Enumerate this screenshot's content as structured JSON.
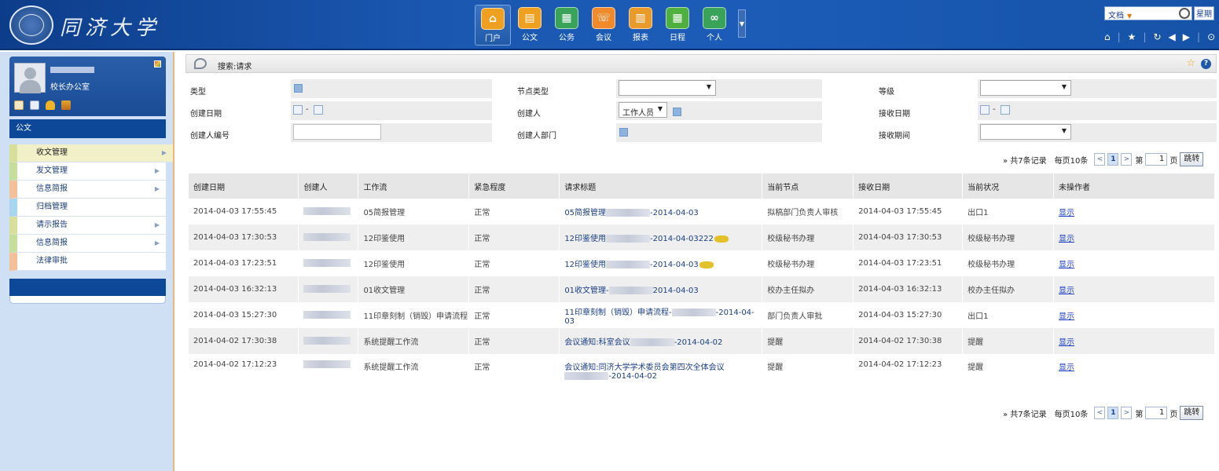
{
  "header": {
    "logo_text": "同济大学",
    "nav": [
      {
        "label": "门户",
        "icon": "home-icon",
        "color": "#f0a020",
        "glyph": "⌂",
        "active": true
      },
      {
        "label": "公文",
        "icon": "document-icon",
        "color": "#f0a020",
        "glyph": "▤"
      },
      {
        "label": "公务",
        "icon": "affairs-icon",
        "color": "#3aa35a",
        "glyph": "▦"
      },
      {
        "label": "会议",
        "icon": "meeting-icon",
        "color": "#f08a2a",
        "glyph": "☏"
      },
      {
        "label": "报表",
        "icon": "report-icon",
        "color": "#e89a2a",
        "glyph": "▥"
      },
      {
        "label": "日程",
        "icon": "schedule-icon",
        "color": "#4fb040",
        "glyph": "▦"
      },
      {
        "label": "个人",
        "icon": "personal-icon",
        "color": "#3aa35a",
        "glyph": "∞"
      }
    ],
    "search_scope": "文档",
    "weekday": "星期"
  },
  "sidebar": {
    "user_dept": "校长办公室",
    "section": "公文",
    "items": [
      {
        "label": "收文管理",
        "accent": "#d8df9a",
        "active": true,
        "arrow": true
      },
      {
        "label": "发文管理",
        "accent": "#c5df9a",
        "arrow": true
      },
      {
        "label": "信息简报",
        "accent": "#f2c19a",
        "arrow": true
      },
      {
        "label": "归档管理",
        "accent": "#a9d6ef",
        "arrow": false
      },
      {
        "label": "请示报告",
        "accent": "#d8df9a",
        "arrow": true
      },
      {
        "label": "信息简报",
        "accent": "#c5df9a",
        "arrow": true
      },
      {
        "label": "法律审批",
        "accent": "#f2c19a",
        "arrow": false
      }
    ]
  },
  "main": {
    "crumb": "搜索:请求",
    "filter": {
      "type_label": "类型",
      "node_type_label": "节点类型",
      "level_label": "等级",
      "created_date_label": "创建日期",
      "creator_label": "创建人",
      "creator_select": "工作人员",
      "received_date_label": "接收日期",
      "creator_no_label": "创建人编号",
      "creator_dept_label": "创建人部门",
      "receive_period_label": "接收期间",
      "date_dash": "-"
    },
    "pager": {
      "total": "» 共7条记录",
      "per_page": "每页10条",
      "prev": "<",
      "page": "1",
      "next": ">",
      "page_prefix": "第",
      "page_input": "1",
      "page_suffix": "页",
      "jump": "跳转"
    },
    "table": {
      "headers": [
        "创建日期",
        "创建人",
        "工作流",
        "紧急程度",
        "请求标题",
        "当前节点",
        "接收日期",
        "当前状况",
        "未操作者"
      ],
      "rows": [
        {
          "date": "2014-04-03 17:55:45",
          "workflow": "05简报管理",
          "urgency": "正常",
          "title_pre": "05简报管理",
          "title_post": "-2014-04-03",
          "hot": false,
          "node": "拟稿部门负责人审核",
          "recv": "2014-04-03 17:55:45",
          "status": "出口1",
          "op": "显示"
        },
        {
          "date": "2014-04-03 17:30:53",
          "workflow": "12印鉴使用",
          "urgency": "正常",
          "title_pre": "12印鉴使用",
          "title_post": "-2014-04-03222",
          "hot": true,
          "node": "校级秘书办理",
          "recv": "2014-04-03 17:30:53",
          "status": "校级秘书办理",
          "op": "显示"
        },
        {
          "date": "2014-04-03 17:23:51",
          "workflow": "12印鉴使用",
          "urgency": "正常",
          "title_pre": "12印鉴使用",
          "title_post": "-2014-04-03",
          "hot": true,
          "node": "校级秘书办理",
          "recv": "2014-04-03 17:23:51",
          "status": "校级秘书办理",
          "op": "显示"
        },
        {
          "date": "2014-04-03 16:32:13",
          "workflow": "01收文管理",
          "urgency": "正常",
          "title_pre": "01收文管理-",
          "title_post": "2014-04-03",
          "hot": false,
          "node": "校办主任拟办",
          "recv": "2014-04-03 16:32:13",
          "status": "校办主任拟办",
          "op": "显示"
        },
        {
          "date": "2014-04-03 15:27:30",
          "workflow": "11印章刻制（销毁）申请流程",
          "urgency": "正常",
          "title_pre": "11印章刻制（销毁）申请流程-",
          "title_post": "-2014-04-03",
          "hot": false,
          "node": "部门负责人审批",
          "recv": "2014-04-03 15:27:30",
          "status": "出口1",
          "op": "显示"
        },
        {
          "date": "2014-04-02 17:30:38",
          "workflow": "系统提醒工作流",
          "urgency": "正常",
          "title_pre": "会议通知:科室会议",
          "title_post": "-2014-04-02",
          "hot": false,
          "node": "提醒",
          "recv": "2014-04-02 17:30:38",
          "status": "提醒",
          "op": "显示"
        },
        {
          "date": "2014-04-02 17:12:23",
          "workflow": "系统提醒工作流",
          "urgency": "正常",
          "title_pre": "会议通知:同济大学学术委员会第四次全体会议",
          "title_post": "-2014-04-02",
          "hot": false,
          "node": "提醒",
          "recv": "2014-04-02 17:12:23",
          "status": "提醒",
          "op": "显示",
          "tall": true
        }
      ]
    }
  }
}
